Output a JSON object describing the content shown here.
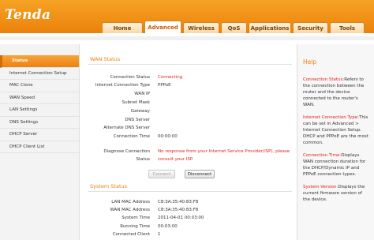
{
  "brand": {
    "logo": "Tenda"
  },
  "nav": {
    "tabs": [
      {
        "label": "Home"
      },
      {
        "label": "Advanced"
      },
      {
        "label": "Wireless"
      },
      {
        "label": "QoS"
      },
      {
        "label": "Applications"
      },
      {
        "label": "Security"
      },
      {
        "label": "Tools"
      }
    ],
    "active_tab": "Advanced"
  },
  "sidebar": {
    "items": [
      {
        "label": "Status"
      },
      {
        "label": "Internet Connection Setup"
      },
      {
        "label": "MAC Clone"
      },
      {
        "label": "WAN Speed"
      },
      {
        "label": "LAN Settings"
      },
      {
        "label": "DNS Settings"
      },
      {
        "label": "DHCP Server"
      },
      {
        "label": "DHCP Client List"
      }
    ],
    "active_item": "Status"
  },
  "wan": {
    "title": "WAN Status",
    "rows": [
      {
        "label": "Connection Status",
        "value": "Connecting"
      },
      {
        "label": "Internet Connection Type",
        "value": "PPPoE"
      },
      {
        "label": "WAN IP",
        "value": ""
      },
      {
        "label": "Subnet Mask",
        "value": ""
      },
      {
        "label": "Gateway",
        "value": ""
      },
      {
        "label": "DNS Server",
        "value": ""
      },
      {
        "label": "Alternate DNS Server",
        "value": ""
      },
      {
        "label": "Connection Time",
        "value": "00:00:00"
      }
    ],
    "diagnose": {
      "label_line1": "Diagnose Connection",
      "label_line2": "Status",
      "value": "No response from your Internet Service Provider(ISP), please consult your ISP."
    },
    "connect_label": "Connect",
    "disconnect_label": "Disconnect"
  },
  "system": {
    "title": "System Status",
    "rows": [
      {
        "label": "LAN MAC Address",
        "value": "C8:3A:35:40:83:F8"
      },
      {
        "label": "WAN MAC Address",
        "value": "C8:3A:35:40:83:F8"
      },
      {
        "label": "System Time",
        "value": "2011-04-01 00:03:00"
      },
      {
        "label": "Running Time",
        "value": "00:03:00"
      },
      {
        "label": "Connected Client",
        "value": "1"
      }
    ]
  },
  "help": {
    "title": "Help",
    "sections": [
      {
        "term": "Connection Status:",
        "text": "Refers to the connection between the router and the device connected to the router's WAN."
      },
      {
        "term": "Internet Connection Type:",
        "text": "This can be set in Advanced > Internet Connection Setup. DHCP and PPPoE are the most common."
      },
      {
        "term": "Connection Time:",
        "text": "Displays WAN connection duration for the DHCP/Dynamic IP and PPPoE connection types."
      },
      {
        "term": "System Version:",
        "text": "Displays the current firmware version of the device."
      }
    ]
  },
  "colors": {
    "accent": "#ef8d14",
    "error": "#e02020"
  }
}
